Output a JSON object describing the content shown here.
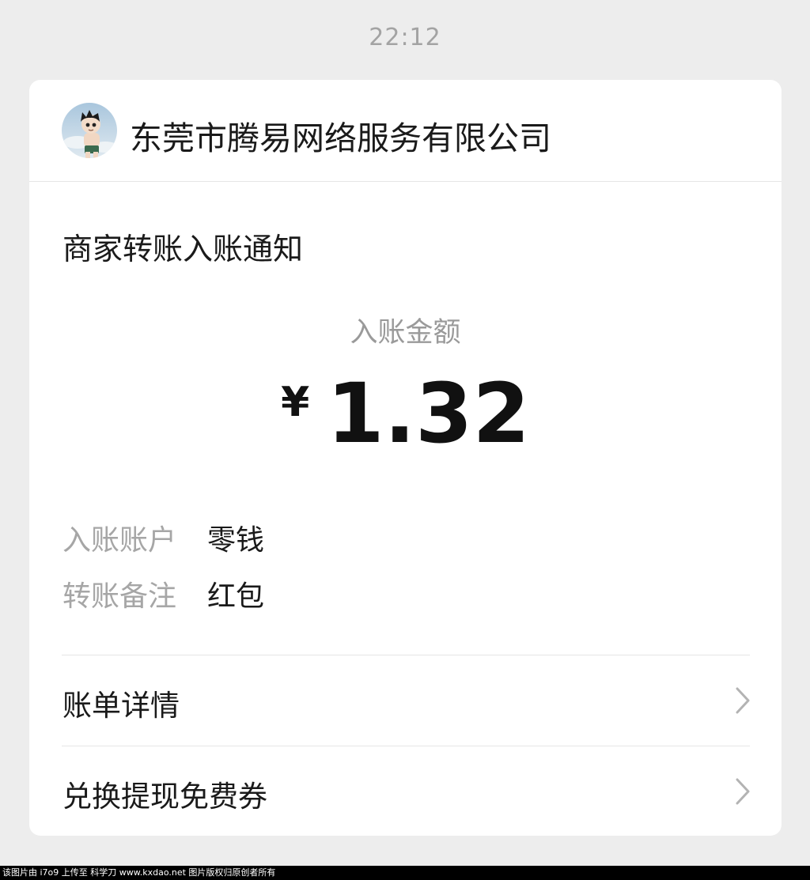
{
  "timestamp": "22:12",
  "card": {
    "merchant_name": "东莞市腾易网络服务有限公司",
    "notice_title": "商家转账入账通知",
    "amount_label": "入账金额",
    "currency_symbol": "¥",
    "amount": "1.32",
    "details": [
      {
        "key": "入账账户",
        "value": "零钱"
      },
      {
        "key": "转账备注",
        "value": "红包"
      }
    ],
    "menu": [
      {
        "label": "账单详情",
        "icon": "chevron-right-icon"
      },
      {
        "label": "兑换提现免费券",
        "icon": "chevron-right-icon"
      }
    ]
  },
  "watermark": "该图片由 i7o9 上传至 科学刀 www.kxdao.net 图片版权归原创者所有",
  "colors": {
    "background": "#ededed",
    "card": "#ffffff",
    "text_primary": "#1a1a1a",
    "text_secondary": "#a6a6a6",
    "divider": "#e6e6e6"
  }
}
